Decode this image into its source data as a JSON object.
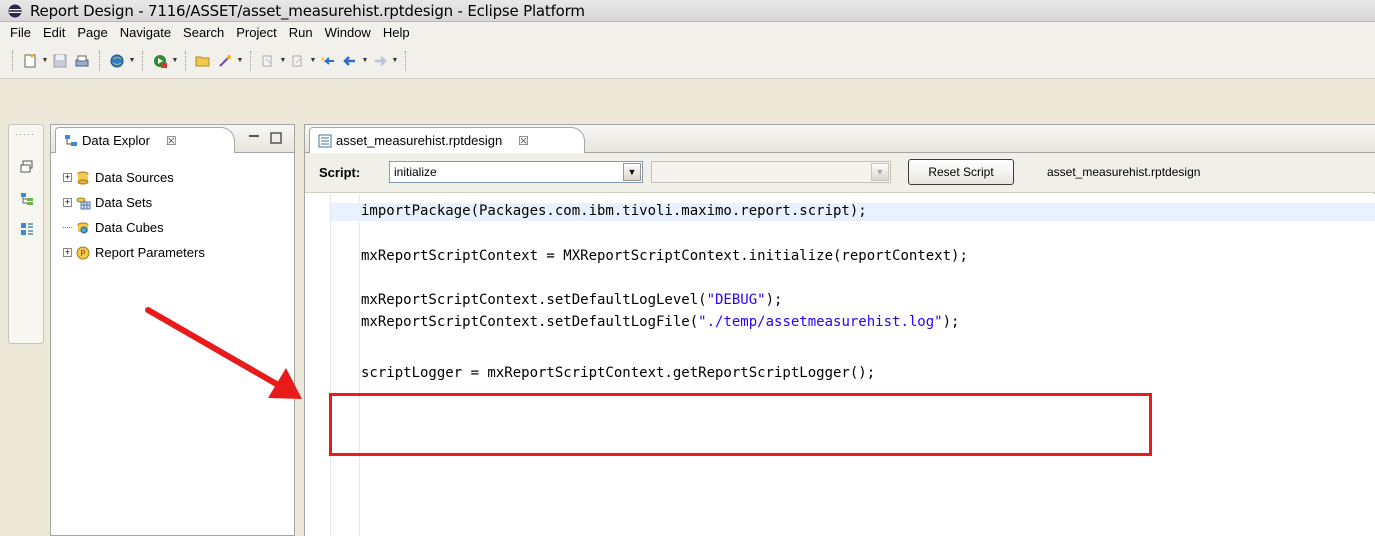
{
  "window": {
    "title": "Report Design - 7116/ASSET/asset_measurehist.rptdesign - Eclipse Platform"
  },
  "menu": [
    "File",
    "Edit",
    "Page",
    "Navigate",
    "Search",
    "Project",
    "Run",
    "Window",
    "Help"
  ],
  "explorer": {
    "tab_label": "Data Explor",
    "tab_close": "☒",
    "tree": [
      {
        "label": "Data Sources",
        "expandable": true,
        "icon": "database-icon"
      },
      {
        "label": "Data Sets",
        "expandable": true,
        "icon": "dataset-icon"
      },
      {
        "label": "Data Cubes",
        "expandable": false,
        "icon": "cube-icon"
      },
      {
        "label": "Report Parameters",
        "expandable": true,
        "icon": "parameter-icon"
      }
    ]
  },
  "editor": {
    "tab_label": "asset_measurehist.rptdesign",
    "tab_close": "☒",
    "script_label": "Script:",
    "script_select": "initialize",
    "second_select": "",
    "reset_button": "Reset Script",
    "file_name": "asset_measurehist.rptdesign",
    "code": {
      "line1": "importPackage(Packages.com.ibm.tivoli.maximo.report.script);",
      "line2": "mxReportScriptContext = MXReportScriptContext.initialize(reportContext);",
      "line3_pre": "mxReportScriptContext.setDefaultLogLevel(",
      "line3_str": "\"DEBUG\"",
      "line3_post": ");",
      "line4_pre": "mxReportScriptContext.setDefaultLogFile(",
      "line4_str": "\"./temp/assetmeasurehist.log\"",
      "line4_post": ");",
      "line5": "scriptLogger = mxReportScriptContext.getReportScriptLogger();"
    }
  },
  "annotation": {
    "arrow_color": "#e81a1a",
    "box_color": "#e81a1a"
  }
}
